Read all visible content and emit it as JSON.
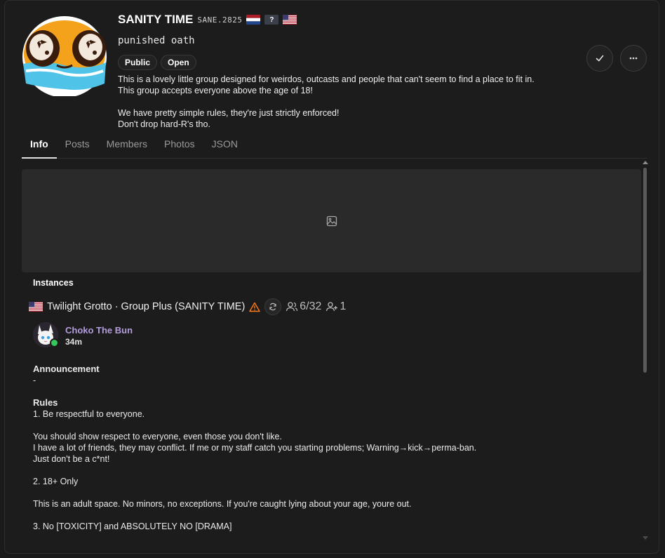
{
  "header": {
    "group_name": "SANITY TIME",
    "group_code": "SANE.2825",
    "flags": [
      "netherlands-flag",
      "unknown-flag",
      "usa-flag"
    ],
    "unknown_badge": "?",
    "subtitle": "punished oath",
    "chips": [
      "Public",
      "Open"
    ],
    "description": [
      "This is a lovely little group designed for weirdos, outcasts and people that can't seem to find a place to fit in.",
      "This group accepts everyone above the age of 18!",
      "",
      "We have pretty simple rules, they're just strictly enforced!",
      "Don't drop hard-R's tho."
    ]
  },
  "actions": {
    "confirm_icon": "check-icon",
    "more_icon": "ellipsis-icon"
  },
  "tabs": [
    {
      "label": "Info",
      "active": true
    },
    {
      "label": "Posts"
    },
    {
      "label": "Members"
    },
    {
      "label": "Photos"
    },
    {
      "label": "JSON"
    }
  ],
  "instances": {
    "title": "Instances",
    "instance": {
      "flag": "usa-flag",
      "name": "Twilight Grotto · Group Plus (SANITY TIME)",
      "users": "6/32",
      "friends": "1"
    },
    "user": {
      "name": "Choko The Bun",
      "time": "34m"
    }
  },
  "content": {
    "announcement_title": "Announcement",
    "announcement_text": "-",
    "rules_title": "Rules",
    "lines": [
      "1. Be respectful to everyone.",
      "",
      "You should show respect to everyone, even those you don't like.",
      "I have a lot of friends, they may conflict. If me or my staff catch you starting problems; Warning→kick→perma-ban.",
      "Just don't be a c*nt!",
      "",
      "2. 18+ Only",
      "",
      "This is an adult space. No minors, no exceptions. If you're caught lying about your age, youre out.",
      "",
      "3. No [TOXICITY] and ABSOLUTELY NO [DRAMA]"
    ]
  },
  "colors": {
    "accent_user": "#b39ddb",
    "online": "#35c759",
    "warning": "#ff7a1a"
  }
}
